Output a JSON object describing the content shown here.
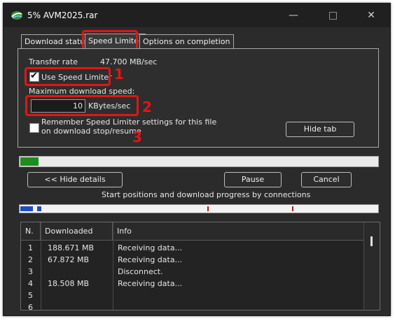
{
  "window": {
    "title": "5% AVM2025.rar"
  },
  "titlebar": {
    "minimize_glyph": "—",
    "close_glyph": "✕"
  },
  "tabs": [
    {
      "label": "Download status"
    },
    {
      "label": "Speed Limiter"
    },
    {
      "label": "Options on completion"
    }
  ],
  "speed_limiter": {
    "transfer_rate_label": "Transfer rate",
    "transfer_rate_value": "47.700  MB/sec",
    "use_limiter_label": "Use Speed Limiter",
    "use_limiter_checked": true,
    "max_speed_label": "Maximum download speed:",
    "max_speed_value": "10",
    "max_speed_unit": "KBytes/sec",
    "remember_line1": "Remember Speed Limiter settings for this file",
    "remember_line2": "on download stop/resume",
    "remember_checked": false,
    "hide_tab_label": "Hide tab"
  },
  "callouts": {
    "one": "1",
    "two": "2",
    "three": "3"
  },
  "progress": {
    "percent": 5
  },
  "actions": {
    "hide_details_label": "<< Hide details",
    "pause_label": "Pause",
    "cancel_label": "Cancel"
  },
  "connections_caption": "Start positions and download progress by connections",
  "table": {
    "headers": [
      "N.",
      "Downloaded",
      "Info"
    ],
    "rows": [
      {
        "n": "1",
        "downloaded": "188.671  MB",
        "info": "Receiving data..."
      },
      {
        "n": "2",
        "downloaded": "67.872  MB",
        "info": "Receiving data..."
      },
      {
        "n": "3",
        "downloaded": "",
        "info": "Disconnect."
      },
      {
        "n": "4",
        "downloaded": "18.508  MB",
        "info": "Receiving data..."
      },
      {
        "n": "5",
        "downloaded": "",
        "info": ""
      },
      {
        "n": "6",
        "downloaded": "",
        "info": ""
      }
    ]
  },
  "colors": {
    "accent_red": "#e01616",
    "progress_green": "#1e8c1e",
    "connection_blue": "#1e4fbf"
  }
}
